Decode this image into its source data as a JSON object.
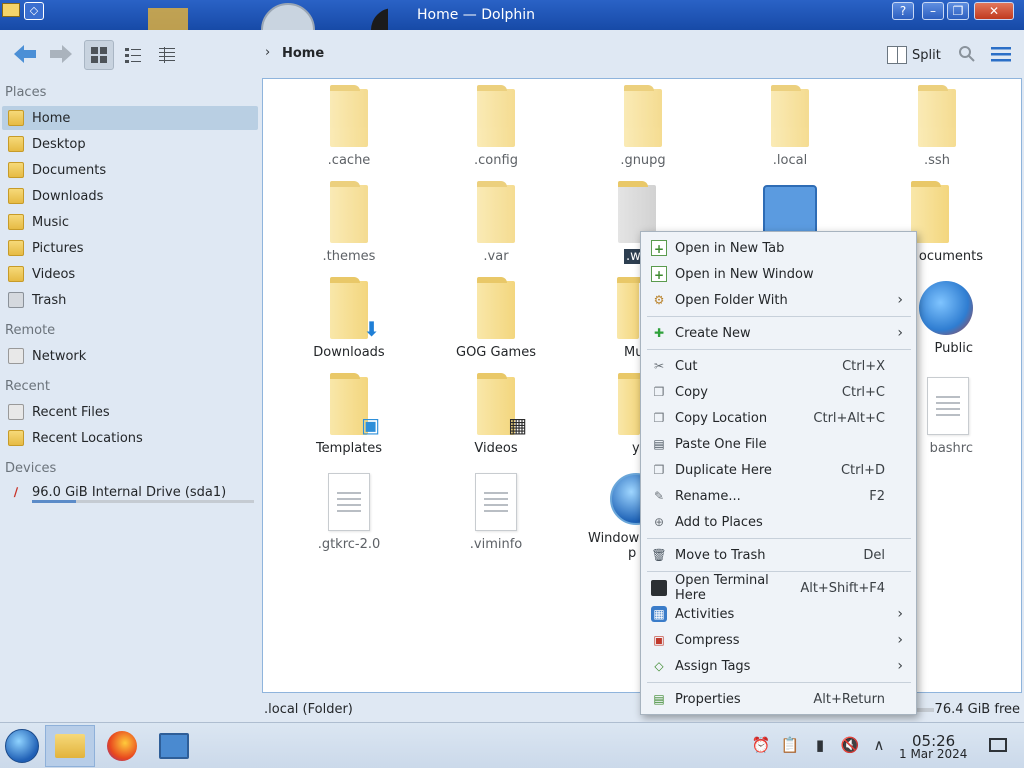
{
  "window": {
    "title": "Home — Dolphin",
    "buttons": {
      "help": "?",
      "minimize": "–",
      "maximize": "❐",
      "close": "✕"
    }
  },
  "toolbar": {
    "breadcrumb": "Home",
    "split_label": "Split"
  },
  "sidebar": {
    "sections": [
      {
        "title": "Places",
        "items": [
          {
            "label": "Home",
            "icon": "home-folder-icon",
            "active": true
          },
          {
            "label": "Desktop",
            "icon": "desktop-icon"
          },
          {
            "label": "Documents",
            "icon": "documents-folder-icon"
          },
          {
            "label": "Downloads",
            "icon": "downloads-folder-icon"
          },
          {
            "label": "Music",
            "icon": "music-folder-icon"
          },
          {
            "label": "Pictures",
            "icon": "pictures-folder-icon"
          },
          {
            "label": "Videos",
            "icon": "videos-folder-icon"
          },
          {
            "label": "Trash",
            "icon": "trash-icon"
          }
        ]
      },
      {
        "title": "Remote",
        "items": [
          {
            "label": "Network",
            "icon": "network-icon"
          }
        ]
      },
      {
        "title": "Recent",
        "items": [
          {
            "label": "Recent Files",
            "icon": "recent-files-icon"
          },
          {
            "label": "Recent Locations",
            "icon": "recent-locations-icon"
          }
        ]
      },
      {
        "title": "Devices",
        "items": [
          {
            "label": "96.0 GiB Internal Drive (sda1)",
            "icon": "drive-icon",
            "usage_fraction": 0.2
          }
        ]
      }
    ]
  },
  "files": [
    {
      "name": ".cache",
      "type": "folder",
      "hidden": true
    },
    {
      "name": ".config",
      "type": "folder",
      "hidden": true
    },
    {
      "name": ".gnupg",
      "type": "folder",
      "hidden": true
    },
    {
      "name": ".local",
      "type": "folder",
      "hidden": true
    },
    {
      "name": ".ssh",
      "type": "folder",
      "hidden": true
    },
    {
      "name": ".themes",
      "type": "folder",
      "hidden": true
    },
    {
      "name": ".var",
      "type": "folder",
      "hidden": true
    },
    {
      "name": ".w",
      "type": "folder",
      "hidden": true,
      "selected": true
    },
    {
      "name": "",
      "type": "app",
      "hidden": false
    },
    {
      "name": "ocuments",
      "type": "folder",
      "hidden": false
    },
    {
      "name": "Downloads",
      "type": "folder",
      "hidden": false
    },
    {
      "name": "GOG Games",
      "type": "folder",
      "hidden": false
    },
    {
      "name": "Mu",
      "type": "folder",
      "hidden": false
    },
    {
      "name": "Public",
      "type": "folder",
      "hidden": false
    },
    {
      "name": "Templates",
      "type": "folder",
      "hidden": false
    },
    {
      "name": "Videos",
      "type": "folder",
      "hidden": false
    },
    {
      "name": "ya",
      "type": "folder",
      "hidden": false
    },
    {
      "name": "bashrc",
      "type": "doc",
      "hidden": true
    },
    {
      "name": ".gtkrc-2.0",
      "type": "doc",
      "hidden": true
    },
    {
      "name": ".viminfo",
      "type": "doc",
      "hidden": true
    },
    {
      "name": "Window",
      "type": "windows",
      "hidden": false
    },
    {
      "name": "p",
      "type": "windows-sub",
      "hidden": false
    }
  ],
  "status": {
    "selection": ".local (Folder)",
    "free_space": "76.4 GiB free"
  },
  "context_menu": {
    "items": [
      {
        "label": "Open in New Tab",
        "shortcut": "",
        "submenu": false,
        "icon": "new-tab-icon"
      },
      {
        "label": "Open in New Window",
        "shortcut": "",
        "submenu": false,
        "icon": "new-window-icon"
      },
      {
        "label": "Open Folder With",
        "shortcut": "",
        "submenu": true,
        "icon": "open-with-icon"
      },
      {
        "label": "Create New",
        "shortcut": "",
        "submenu": true,
        "icon": "create-new-icon"
      },
      {
        "label": "Cut",
        "shortcut": "Ctrl+X",
        "submenu": false,
        "icon": "cut-icon"
      },
      {
        "label": "Copy",
        "shortcut": "Ctrl+C",
        "submenu": false,
        "icon": "copy-icon"
      },
      {
        "label": "Copy Location",
        "shortcut": "Ctrl+Alt+C",
        "submenu": false,
        "icon": "copy-location-icon"
      },
      {
        "label": "Paste One File",
        "shortcut": "",
        "submenu": false,
        "icon": "paste-icon"
      },
      {
        "label": "Duplicate Here",
        "shortcut": "Ctrl+D",
        "submenu": false,
        "icon": "duplicate-icon"
      },
      {
        "label": "Rename...",
        "shortcut": "F2",
        "submenu": false,
        "icon": "rename-icon"
      },
      {
        "label": "Add to Places",
        "shortcut": "",
        "submenu": false,
        "icon": "add-to-places-icon"
      },
      {
        "label": "Move to Trash",
        "shortcut": "Del",
        "submenu": false,
        "icon": "trash-icon"
      },
      {
        "label": "Open Terminal Here",
        "shortcut": "Alt+Shift+F4",
        "submenu": false,
        "icon": "terminal-icon"
      },
      {
        "label": "Activities",
        "shortcut": "",
        "submenu": true,
        "icon": "activities-icon"
      },
      {
        "label": "Compress",
        "shortcut": "",
        "submenu": true,
        "icon": "compress-icon"
      },
      {
        "label": "Assign Tags",
        "shortcut": "",
        "submenu": true,
        "icon": "tag-icon"
      },
      {
        "label": "Properties",
        "shortcut": "Alt+Return",
        "submenu": false,
        "icon": "properties-icon"
      }
    ]
  },
  "taskbar": {
    "clock_time": "05:26",
    "clock_date": "1 Mar 2024"
  },
  "colors": {
    "accent": "#3daee9",
    "selection": "#b9cfe3",
    "titlebar": "#1f55b6"
  }
}
